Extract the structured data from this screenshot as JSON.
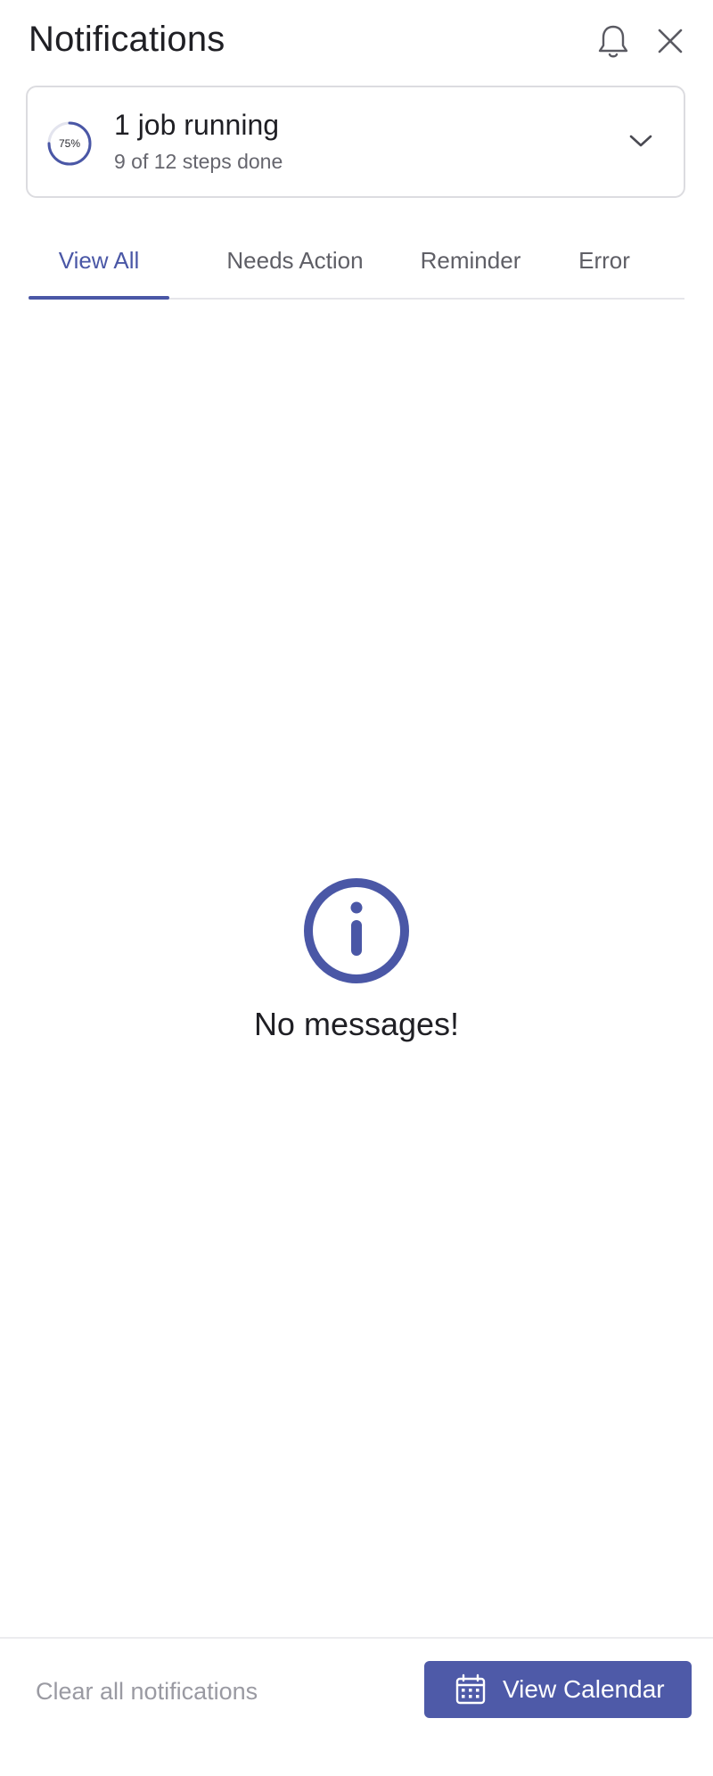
{
  "header": {
    "title": "Notifications",
    "bell_icon": "bell-icon",
    "close_icon": "close-icon"
  },
  "job": {
    "progress_percent": 75,
    "progress_label": "75%",
    "title": "1 job running",
    "subtitle": "9 of 12 steps done",
    "expand_icon": "chevron-down-icon"
  },
  "tabs": [
    {
      "label": "View All",
      "active": true
    },
    {
      "label": "Needs Action",
      "active": false
    },
    {
      "label": "Reminder",
      "active": false
    },
    {
      "label": "Error",
      "active": false
    }
  ],
  "empty_state": {
    "icon": "info-icon",
    "message": "No messages!"
  },
  "footer": {
    "clear_label": "Clear all notifications",
    "calendar_label": "View Calendar",
    "calendar_icon": "calendar-icon"
  },
  "colors": {
    "accent": "#4a57a6",
    "button_bg": "#4e5aa8",
    "muted_text": "#9a9aa2"
  }
}
